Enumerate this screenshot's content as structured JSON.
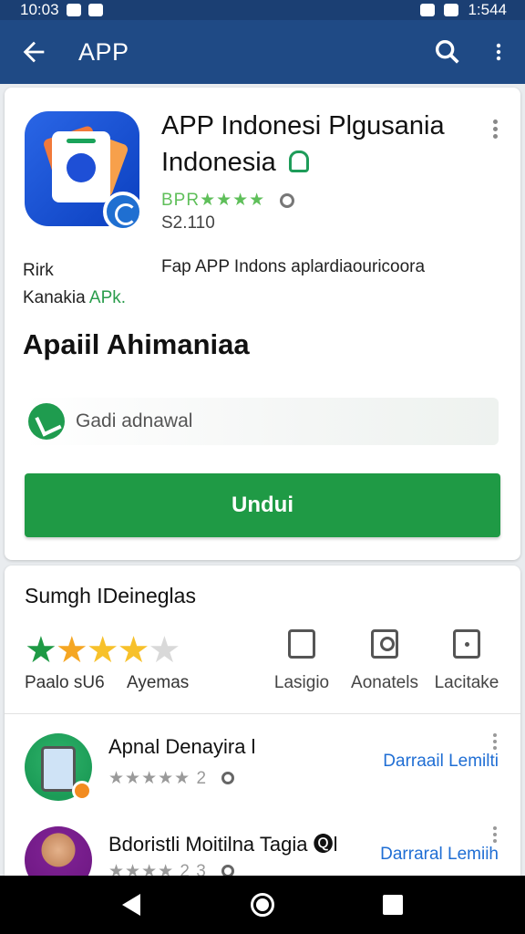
{
  "status_bar": {
    "time_left": "10:03",
    "time_right": "1:544"
  },
  "app_bar": {
    "title": "APP",
    "back_icon": "back-arrow-icon",
    "search_icon": "search-icon",
    "more_icon": "more-vert-icon"
  },
  "app": {
    "title": "APP Indonesi Plgusania Indonesia",
    "rating_label": "BPR★★★★",
    "price": "S2.110",
    "meta_left_line1": "Rirk",
    "meta_left_line2_prefix": "Kanakia ",
    "meta_left_line2_apk": "APk.",
    "meta_right": "Fap  APP Indons aplardiaouricoora",
    "section_title": "Apaiil Ahimaniaa",
    "install_status": "Gadi adnawal",
    "install_button": "Undui"
  },
  "ratings_card": {
    "title": "Sumgh IDeineglas",
    "stars_filled": 4.5,
    "count_label": "Paalo sU6",
    "note_label": "Ayemas",
    "actions": [
      {
        "label": "Lasigio",
        "icon": "bookmark-icon"
      },
      {
        "label": "Aonatels",
        "icon": "profile-icon"
      },
      {
        "label": "Lacitake",
        "icon": "share-icon"
      }
    ],
    "items": [
      {
        "title": "Apnal Denayira l",
        "rating": "★★★★★ 2",
        "link": "Darraail Lemilti"
      },
      {
        "title": "Bdoristli  Moitilna Tagia 🅠l",
        "rating": "★★★★ 2 3",
        "link": "Darraral Lemiih"
      }
    ]
  },
  "colors": {
    "app_bar": "#1f4a85",
    "install_green": "#1f9a45",
    "link_blue": "#1f6ed4"
  }
}
